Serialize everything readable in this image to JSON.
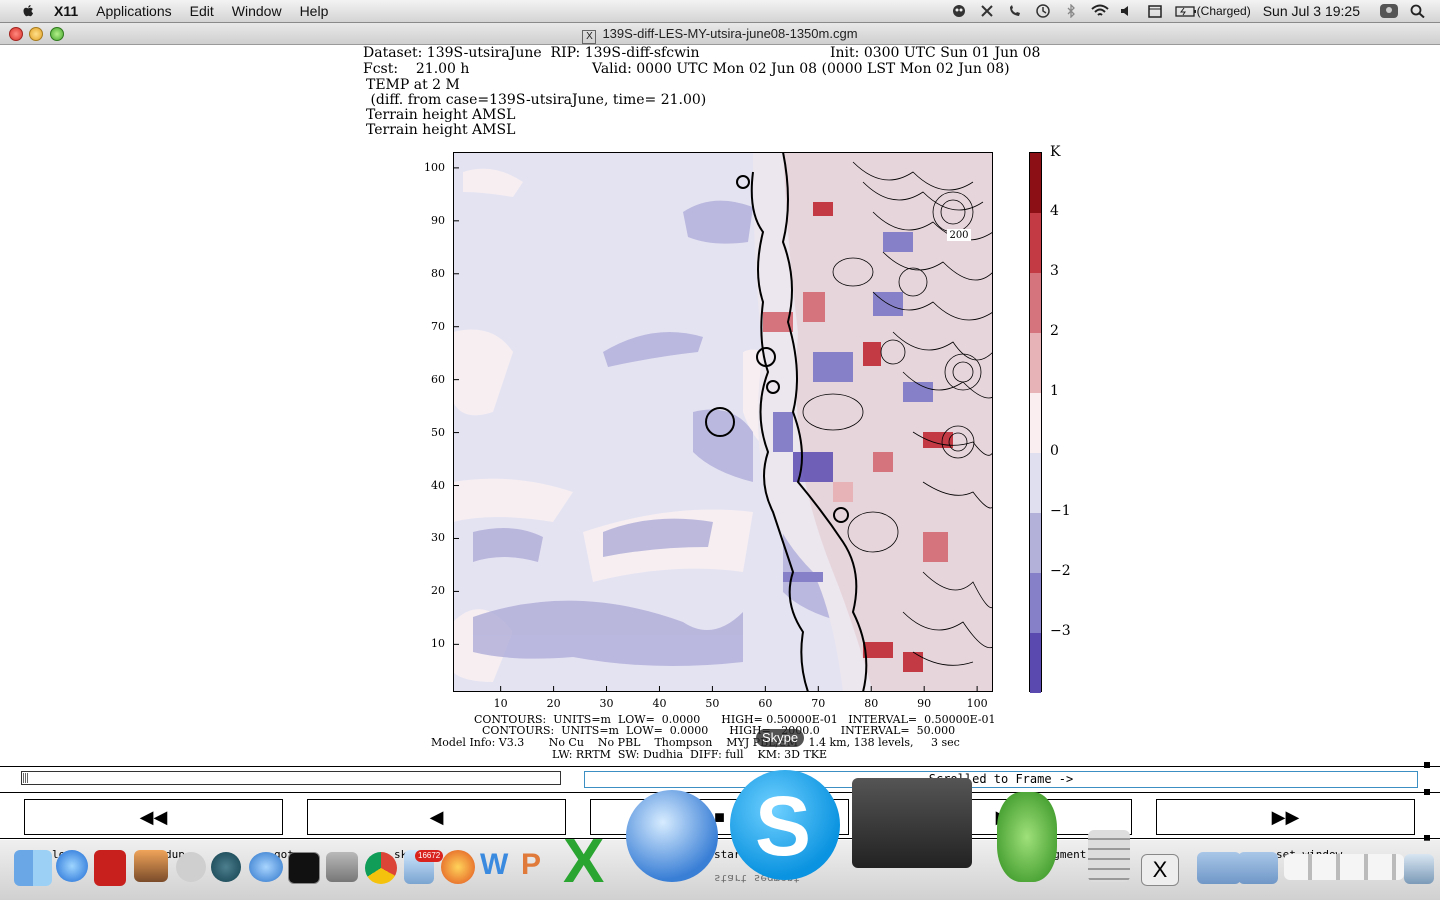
{
  "menubar": {
    "app_name": "X11",
    "menus": [
      "Applications",
      "Edit",
      "Window",
      "Help"
    ],
    "battery": "(Charged)",
    "clock": "Sun Jul 3  19:25"
  },
  "window": {
    "title": "139S-diff-LES-MY-utsira-june08-1350m.cgm"
  },
  "header": {
    "line1_left": "Dataset: 139S-utsiraJune  RIP: 139S-diff-sfcwin",
    "line1_right": "Init: 0300 UTC Sun 01 Jun 08",
    "line2_left": "Fcst:    21.00 h",
    "line2_right": "Valid: 0000 UTC Mon 02 Jun 08 (0000 LST Mon 02 Jun 08)",
    "line3": "TEMP at 2 M",
    "line4": " (diff. from case=139S-utsiraJune, time= 21.00)",
    "line5": "Terrain height AMSL",
    "line6": "Terrain height AMSL"
  },
  "chart_data": {
    "type": "heatmap",
    "title": "TEMP at 2 M",
    "xlim": [
      1,
      103
    ],
    "ylim": [
      1,
      103
    ],
    "x_ticks": [
      "10",
      "20",
      "30",
      "40",
      "50",
      "60",
      "70",
      "80",
      "90",
      "100"
    ],
    "y_ticks": [
      "100",
      "90",
      "80",
      "70",
      "60",
      "50",
      "40",
      "30",
      "20",
      "10"
    ],
    "colorbar_unit": "K",
    "colorbar_ticks": [
      "4",
      "3",
      "2",
      "1",
      "0",
      "−1",
      "−2",
      "−3"
    ],
    "colorbar_colors": [
      "#8b0f14",
      "#c33a44",
      "#d5747c",
      "#e8b3b7",
      "#fbeef0",
      "#e0dff0",
      "#b3b0da",
      "#8580c7",
      "#5a4ab0"
    ],
    "contour_label": "200",
    "colors": {
      "land_line": "#000000",
      "background_field": "#e4e3f2"
    }
  },
  "footer": {
    "line1": "CONTOURS:  UNITS=m  LOW=  0.0000      HIGH= 0.50000E-01   INTERVAL=  0.50000E-01",
    "line2": "CONTOURS:  UNITS=m  LOW=  0.0000      HIGH=   2000.0      INTERVAL=  50.000",
    "line3": "Model Info: V3.3       No Cu    No PBL    Thompson    MYJ PBL/SM   1.4 km, 138 levels,     3 sec",
    "line4": "LW: RRTM  SW: Dudhia  DIFF: full    KM: 3D TKE"
  },
  "frame": {
    "status": "Scrolled to Frame ->",
    "buttons": [
      "◀◀",
      "◀",
      "■",
      "▶",
      "▶▶"
    ]
  },
  "skype_tooltip": "Skype",
  "dock": {
    "labels": [
      "lo",
      "dup",
      "goto",
      "skip",
      "start",
      "start segment",
      "segment",
      "set window"
    ],
    "badge": "16672"
  }
}
